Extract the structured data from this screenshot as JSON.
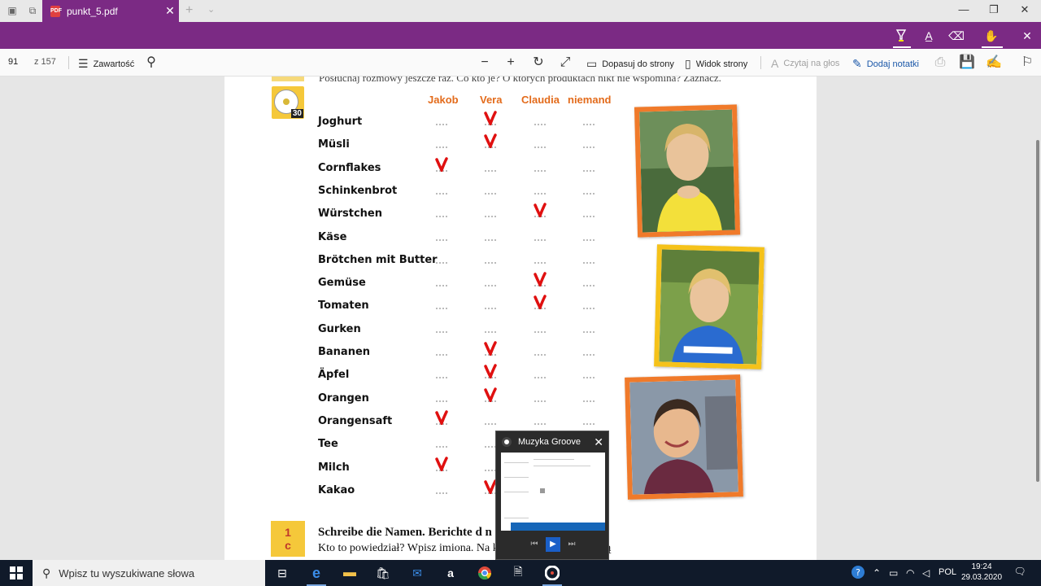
{
  "tab": {
    "title": "punkt_5.pdf",
    "close": "✕"
  },
  "window": {
    "minimize": "—",
    "restore": "❐",
    "close": "✕"
  },
  "toolbar": {
    "page_current": "91",
    "page_total": "z 157",
    "contents": "Zawartość",
    "fit_page": "Dopasuj do strony",
    "page_view": "Widok strony",
    "read_aloud": "Czytaj na głos",
    "add_notes": "Dodaj notatki"
  },
  "doc": {
    "top_line": "Posłuchaj rozmowy jeszcze raz. Co kto je? O których produktach nikt nie wspomina? Zaznacz.",
    "cd_number": "30",
    "columns": [
      "Jakob",
      "Vera",
      "Claudia",
      "niemand"
    ],
    "foods": [
      "Joghurt",
      "Müsli",
      "Cornflakes",
      "Schinkenbrot",
      "Würstchen",
      "Käse",
      "Brötchen mit Butter",
      "Gemüse",
      "Tomaten",
      "Gurken",
      "Bananen",
      "Äpfel",
      "Orangen",
      "Orangensaft",
      "Tee",
      "Milch",
      "Kakao"
    ],
    "checks": [
      {
        "row": 0,
        "col": 1
      },
      {
        "row": 1,
        "col": 1
      },
      {
        "row": 2,
        "col": 0
      },
      {
        "row": 4,
        "col": 2
      },
      {
        "row": 7,
        "col": 2
      },
      {
        "row": 8,
        "col": 2
      },
      {
        "row": 10,
        "col": 1
      },
      {
        "row": 11,
        "col": 1
      },
      {
        "row": 12,
        "col": 1
      },
      {
        "row": 13,
        "col": 0
      },
      {
        "row": 15,
        "col": 0
      },
      {
        "row": 16,
        "col": 1
      }
    ],
    "check_color": "#e01010",
    "exercise_label_top": "1",
    "exercise_label_bottom": "c",
    "exercise_line1": "Schreibe die Namen.  Berichte d                                 n zum Frühstück essen.",
    "exercise_line2": "Kto to powiedział? Wpisz imiona. Na                                  kub, Vera i Klaudia jadają"
  },
  "groove": {
    "title": "Muzyka Groove",
    "close": "✕"
  },
  "taskbar": {
    "search_placeholder": "Wpisz tu wyszukiwane słowa",
    "lang": "POL",
    "time": "19:24",
    "date": "29.03.2020"
  }
}
